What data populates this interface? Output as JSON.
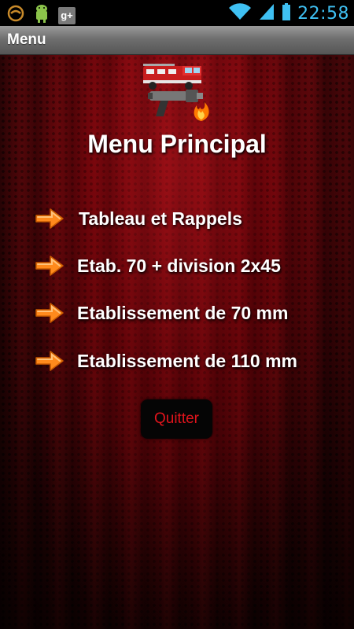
{
  "status_bar": {
    "time": "22:58",
    "notification_icons": [
      "swirl-icon",
      "android-icon",
      "google-plus-icon"
    ],
    "google_plus_label": "g+",
    "wifi_icon": "wifi-icon",
    "signal_icon": "signal-icon",
    "battery_icon": "battery-icon",
    "time_color": "#3fc0f2"
  },
  "action_bar": {
    "title": "Menu"
  },
  "main": {
    "logo_icon": "fire-truck-nozzle-icon",
    "title": "Menu Principal",
    "items": [
      {
        "label": "Tableau et Rappels",
        "icon": "arrow-right-icon"
      },
      {
        "label": "Etab. 70 + division 2x45",
        "icon": "arrow-right-icon"
      },
      {
        "label": "Etablissement de 70 mm",
        "icon": "arrow-right-icon"
      },
      {
        "label": "Etablissement de 110 mm",
        "icon": "arrow-right-icon"
      }
    ],
    "quit_label": "Quitter"
  },
  "colors": {
    "background": "#4a0508",
    "arrow": "#ff8a1c",
    "quit_text": "#e0141c"
  }
}
